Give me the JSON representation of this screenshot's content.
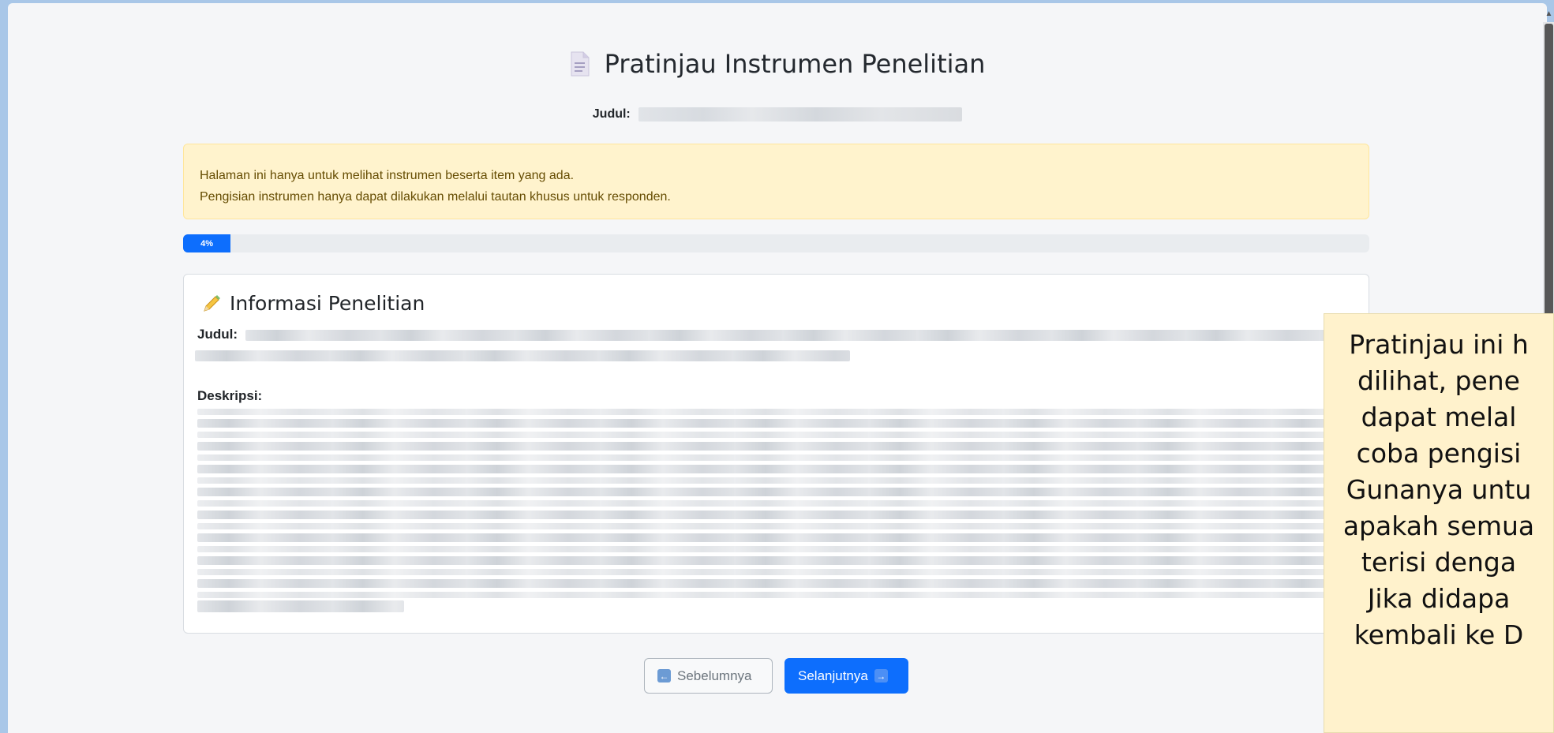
{
  "page": {
    "title": "Pratinjau Instrumen Penelitian",
    "subtitle_label": "Judul:",
    "subtitle_value": ""
  },
  "alert": {
    "line1": "Halaman ini hanya untuk melihat instrumen beserta item yang ada.",
    "line2": "Pengisian instrumen hanya dapat dilakukan melalui tautan khusus untuk responden."
  },
  "progress": {
    "value": 0.04,
    "label": "4%"
  },
  "card": {
    "title": "Informasi Penelitian",
    "judul_label": "Judul:",
    "deskripsi_label": "Deskripsi:"
  },
  "buttons": {
    "prev_label": "Sebelumnya",
    "next_label": "Selanjutnya"
  },
  "tooltip": {
    "lines": [
      "Pratinjau ini h",
      "dilihat, pene",
      "dapat melal",
      "coba pengisi",
      "Gunanya untu",
      "apakah semua",
      "terisi denga",
      "Jika didapa",
      "kembali ke D"
    ]
  },
  "colors": {
    "primary": "#0d6efd",
    "alert_bg": "#fff3cd",
    "alert_text": "#664d03",
    "tooltip_bg": "#fff2cc"
  },
  "icons": {
    "title_icon": "document-icon",
    "card_icon": "pencil-icon",
    "prev_icon": "arrow-left-icon",
    "next_icon": "arrow-right-icon"
  }
}
